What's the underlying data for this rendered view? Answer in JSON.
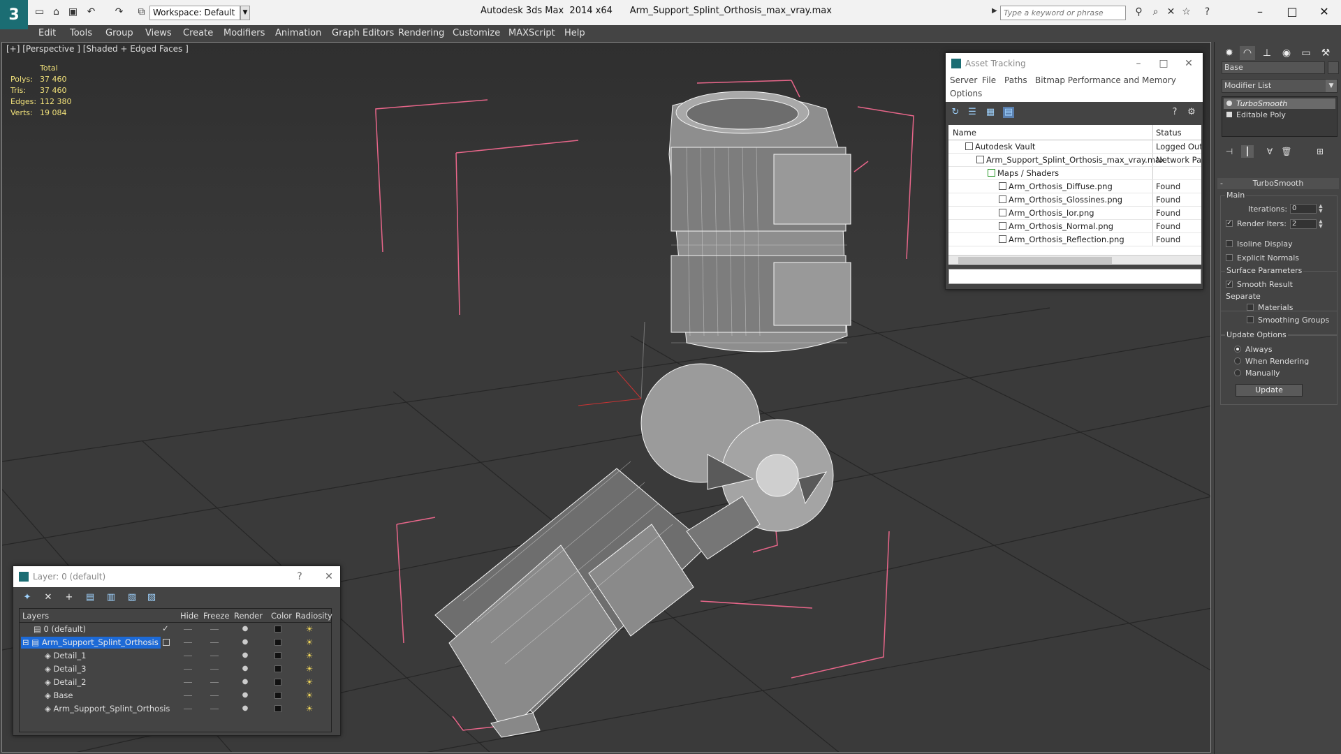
{
  "titlebar": {
    "app": "Autodesk 3ds Max  2014 x64",
    "file": "Arm_Support_Splint_Orthosis_max_vray.max",
    "workspace": "Workspace: Default",
    "search_placeholder": "Type a keyword or phrase"
  },
  "menu": [
    "Edit",
    "Tools",
    "Group",
    "Views",
    "Create",
    "Modifiers",
    "Animation",
    "Graph Editors",
    "Rendering",
    "Customize",
    "MAXScript",
    "Help"
  ],
  "viewport": {
    "label": "[+] [Perspective ] [Shaded + Edged Faces ]",
    "stats_header": "Total",
    "stats": [
      {
        "k": "Polys:",
        "v": "37 460"
      },
      {
        "k": "Tris:",
        "v": "37 460"
      },
      {
        "k": "Edges:",
        "v": "112 380"
      },
      {
        "k": "Verts:",
        "v": "19 084"
      }
    ]
  },
  "asset_tracking": {
    "title": "Asset Tracking",
    "menu": [
      "Server",
      "File",
      "Paths",
      "Bitmap Performance and Memory",
      "Options"
    ],
    "col_name": "Name",
    "col_status": "Status",
    "rows": [
      {
        "name": "Autodesk Vault",
        "status": "Logged Out",
        "indent": 0
      },
      {
        "name": "Arm_Support_Splint_Orthosis_max_vray.max",
        "status": "Network Pat",
        "indent": 1
      },
      {
        "name": "Maps / Shaders",
        "status": "",
        "indent": 2
      },
      {
        "name": "Arm_Orthosis_Diffuse.png",
        "status": "Found",
        "indent": 3
      },
      {
        "name": "Arm_Orthosis_Glossines.png",
        "status": "Found",
        "indent": 3
      },
      {
        "name": "Arm_Orthosis_Ior.png",
        "status": "Found",
        "indent": 3
      },
      {
        "name": "Arm_Orthosis_Normal.png",
        "status": "Found",
        "indent": 3
      },
      {
        "name": "Arm_Orthosis_Reflection.png",
        "status": "Found",
        "indent": 3
      }
    ]
  },
  "layer_dialog": {
    "title": "Layer: 0 (default)",
    "help": "?",
    "columns": [
      "Layers",
      "Hide",
      "Freeze",
      "Render",
      "Color",
      "Radiosity"
    ],
    "rows": [
      {
        "name": "0 (default)",
        "indent": 1,
        "selected": false
      },
      {
        "name": "Arm_Support_Splint_Orthosis",
        "indent": 1,
        "selected": true
      },
      {
        "name": "Detail_1",
        "indent": 2,
        "selected": false
      },
      {
        "name": "Detail_3",
        "indent": 2,
        "selected": false
      },
      {
        "name": "Detail_2",
        "indent": 2,
        "selected": false
      },
      {
        "name": "Base",
        "indent": 2,
        "selected": false
      },
      {
        "name": "Arm_Support_Splint_Orthosis",
        "indent": 2,
        "selected": false
      }
    ]
  },
  "command_panel": {
    "object_name": "Base",
    "modifier_list": "Modifier List",
    "stack": [
      "TurboSmooth",
      "Editable Poly"
    ],
    "rollout_title": "TurboSmooth",
    "main_label": "Main",
    "iterations_label": "Iterations:",
    "iterations": "0",
    "render_iters_label": "Render Iters:",
    "render_iters": "2",
    "isoline": "Isoline Display",
    "explicit_normals": "Explicit Normals",
    "surface_params": "Surface Parameters",
    "smooth_result": "Smooth Result",
    "separate": "Separate",
    "materials": "Materials",
    "smoothing_groups": "Smoothing Groups",
    "update_options": "Update Options",
    "always": "Always",
    "when_rendering": "When Rendering",
    "manually": "Manually",
    "update_btn": "Update"
  },
  "colors": {
    "accent": "#1b6d73",
    "selection": "#1d6ad7",
    "stats": "#f1e17a",
    "bbox": "#e8668a"
  }
}
